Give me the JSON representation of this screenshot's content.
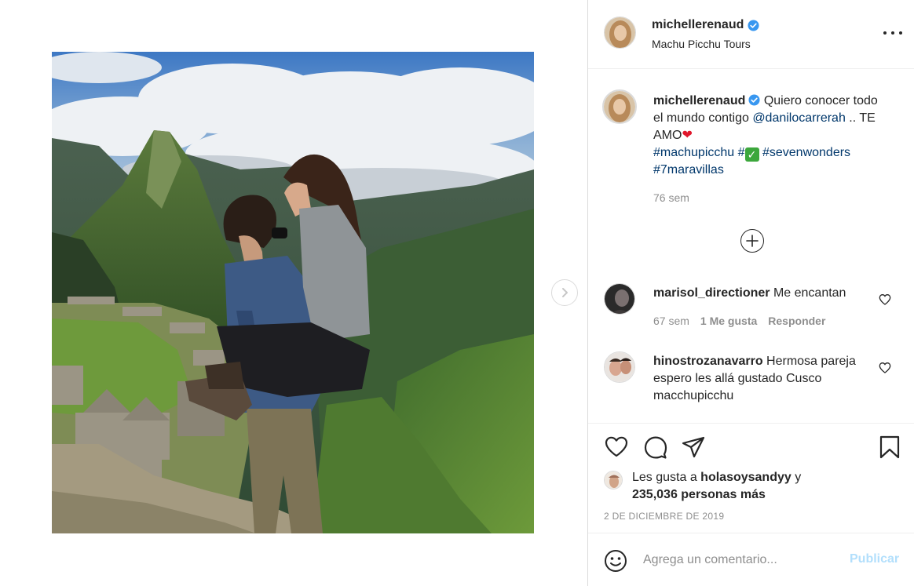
{
  "post": {
    "username": "michellerenaud",
    "location": "Machu Picchu Tours",
    "verified": true
  },
  "caption": {
    "username": "michellerenaud",
    "text_part1": " Quiero conocer todo el mundo contigo ",
    "mention": "@danilocarrerah",
    "text_part2": " .. TE AMO",
    "heart": "❤",
    "hashtag1": "#machupicchu",
    "hashtag2": "#",
    "check_emoji": "✓",
    "hashtag3": "#sevenwonders",
    "hashtag4": "#7maravillas",
    "time": "76 sem"
  },
  "comments": [
    {
      "username": "marisol_directioner",
      "text": " Me encantan",
      "time": "67 sem",
      "likes": "1 Me gusta",
      "reply": "Responder"
    },
    {
      "username": "hinostrozanavarro",
      "text": " Hermosa pareja espero les allá gustado Cusco macchupicchu"
    }
  ],
  "likes": {
    "prefix": "Les gusta a ",
    "user": "holasoysandyy",
    "connector": " y",
    "count": "235,036 personas más"
  },
  "date": "2 DE DICIEMBRE DE 2019",
  "add_comment": {
    "placeholder": "Agrega un comentario...",
    "publish": "Publicar"
  },
  "icons": {
    "verified": "verified-badge-icon",
    "more": "more-options-icon",
    "load_more": "plus-circle-icon",
    "like": "heart-icon",
    "comment": "comment-bubble-icon",
    "share": "paper-plane-icon",
    "save": "bookmark-icon",
    "emoji": "emoji-smiley-icon",
    "next": "chevron-right-icon"
  },
  "colors": {
    "verified": "#3897f0",
    "link": "#00376b",
    "muted": "#8e8e8e",
    "publish_disabled": "#b2dffc"
  }
}
